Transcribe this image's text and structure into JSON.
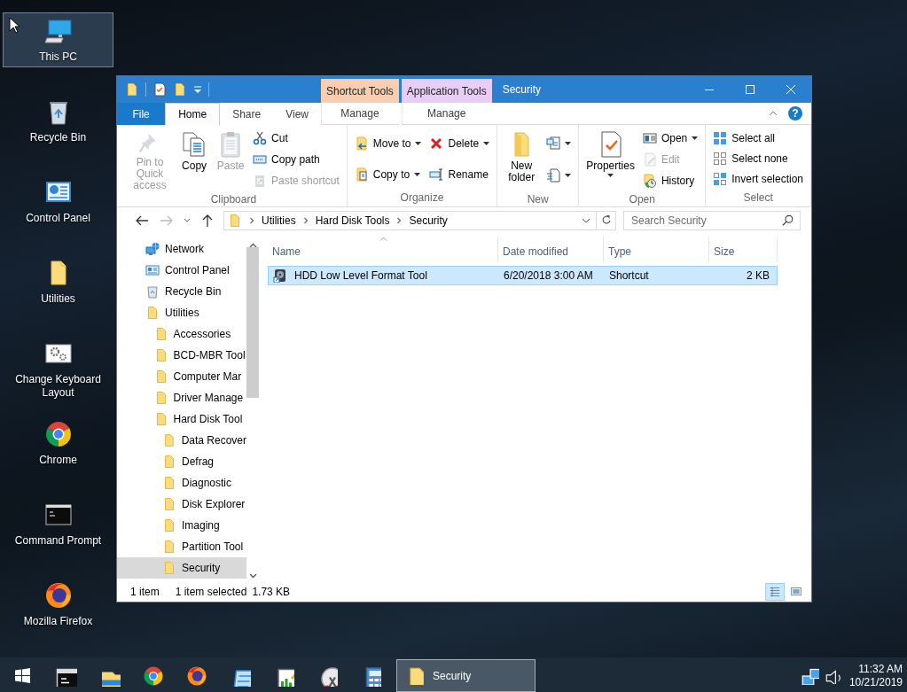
{
  "desktop": {
    "icons": [
      {
        "label": "This PC",
        "selected": true
      },
      {
        "label": "Recycle Bin",
        "selected": false
      },
      {
        "label": "Control Panel",
        "selected": false
      },
      {
        "label": "Utilities",
        "selected": false
      },
      {
        "label": "Change Keyboard Layout",
        "selected": false
      },
      {
        "label": "Chrome",
        "selected": false
      },
      {
        "label": "Command Prompt",
        "selected": false
      },
      {
        "label": "Mozilla Firefox",
        "selected": false
      }
    ]
  },
  "window": {
    "title": "Security",
    "contextual_tabs": [
      {
        "label": "Shortcut Tools",
        "color": "#f8cdb0"
      },
      {
        "label": "Application Tools",
        "color": "#e9cdf6"
      }
    ],
    "tabs": [
      {
        "label": "File",
        "kind": "file",
        "selected": false
      },
      {
        "label": "Home",
        "kind": "tab",
        "selected": true
      },
      {
        "label": "Share",
        "kind": "tab",
        "selected": false
      },
      {
        "label": "View",
        "kind": "tab",
        "selected": false
      },
      {
        "label": "Manage",
        "kind": "contextual",
        "selected": false
      },
      {
        "label": "Manage",
        "kind": "contextual",
        "selected": false
      }
    ],
    "help": "?",
    "ribbon": {
      "groups": [
        {
          "label": "Clipboard",
          "columns": [
            [
              {
                "label": "Pin to Quick access",
                "kind": "large",
                "disabled": true,
                "dropdown": false
              }
            ],
            [
              {
                "label": "Copy",
                "kind": "large",
                "disabled": false,
                "dropdown": false
              }
            ],
            [
              {
                "label": "Paste",
                "kind": "large",
                "disabled": true,
                "dropdown": false
              }
            ],
            [
              {
                "label": "Cut",
                "kind": "small",
                "disabled": false,
                "dropdown": false
              },
              {
                "label": "Copy path",
                "kind": "small",
                "disabled": false,
                "dropdown": false
              },
              {
                "label": "Paste shortcut",
                "kind": "small",
                "disabled": true,
                "dropdown": false
              }
            ]
          ]
        },
        {
          "label": "Organize",
          "columns": [
            [
              {
                "label": "Move to",
                "kind": "small",
                "disabled": false,
                "dropdown": true
              },
              {
                "label": "Copy to",
                "kind": "small",
                "disabled": false,
                "dropdown": true
              }
            ],
            [
              {
                "label": "Delete",
                "kind": "small",
                "disabled": false,
                "dropdown": true
              },
              {
                "label": "Rename",
                "kind": "small",
                "disabled": false,
                "dropdown": false
              }
            ]
          ]
        },
        {
          "label": "New",
          "columns": [
            [
              {
                "label": "New folder",
                "kind": "large",
                "disabled": false,
                "dropdown": false
              }
            ],
            [
              {
                "kind": "icon",
                "disabled": false,
                "dropdown": true
              },
              {
                "kind": "icon",
                "disabled": false,
                "dropdown": true
              }
            ]
          ]
        },
        {
          "label": "Open",
          "columns": [
            [
              {
                "label": "Properties",
                "kind": "large",
                "disabled": false,
                "dropdown": true
              }
            ],
            [
              {
                "label": "Open",
                "kind": "small",
                "disabled": false,
                "dropdown": true
              },
              {
                "label": "Edit",
                "kind": "small",
                "disabled": true,
                "dropdown": false
              },
              {
                "label": "History",
                "kind": "small",
                "disabled": false,
                "dropdown": false
              }
            ]
          ]
        },
        {
          "label": "Select",
          "columns": [
            [
              {
                "label": "Select all",
                "kind": "small",
                "disabled": false,
                "dropdown": false
              },
              {
                "label": "Select none",
                "kind": "small",
                "disabled": false,
                "dropdown": false
              },
              {
                "label": "Invert selection",
                "kind": "small",
                "disabled": false,
                "dropdown": false
              }
            ]
          ]
        }
      ]
    },
    "address": {
      "breadcrumbs": [
        "Utilities",
        "Hard Disk Tools",
        "Security"
      ],
      "search_placeholder": "Search Security"
    },
    "navigation": {
      "items": [
        {
          "label": "Network",
          "kind": "network",
          "selected": false
        },
        {
          "label": "Control Panel",
          "kind": "panel",
          "selected": false
        },
        {
          "label": "Recycle Bin",
          "kind": "bin",
          "selected": false
        },
        {
          "label": "Utilities",
          "kind": "folder",
          "selected": false,
          "children": [
            {
              "label": "Accessories",
              "kind": "folder",
              "selected": false
            },
            {
              "label": "BCD-MBR Tool",
              "kind": "folder",
              "selected": false
            },
            {
              "label": "Computer Mar",
              "kind": "folder",
              "selected": false
            },
            {
              "label": "Driver Manage",
              "kind": "folder",
              "selected": false
            },
            {
              "label": "Hard Disk Tool",
              "kind": "folder",
              "selected": false,
              "children": [
                {
                  "label": "Data Recover",
                  "kind": "folder",
                  "selected": false
                },
                {
                  "label": "Defrag",
                  "kind": "folder",
                  "selected": false
                },
                {
                  "label": "Diagnostic",
                  "kind": "folder",
                  "selected": false
                },
                {
                  "label": "Disk Explorer",
                  "kind": "folder",
                  "selected": false
                },
                {
                  "label": "Imaging",
                  "kind": "folder",
                  "selected": false
                },
                {
                  "label": "Partition Tool",
                  "kind": "folder",
                  "selected": false
                },
                {
                  "label": "Security",
                  "kind": "folder",
                  "selected": true
                }
              ]
            }
          ]
        }
      ]
    },
    "file_list": {
      "columns": [
        {
          "label": "Name",
          "sorted": true
        },
        {
          "label": "Date modified",
          "sorted": false
        },
        {
          "label": "Type",
          "sorted": false
        },
        {
          "label": "Size",
          "sorted": false
        }
      ],
      "rows": [
        {
          "cells": [
            "HDD Low Level Format Tool",
            "6/20/2018 3:00 AM",
            "Shortcut",
            "2 KB"
          ],
          "selected": true
        }
      ]
    },
    "status_bar": {
      "item_count": "1 item",
      "selection": "1 item selected",
      "selection_size": "1.73 KB",
      "views": [
        {
          "selected": true
        },
        {
          "selected": false
        }
      ]
    }
  },
  "taskbar": {
    "windows": [
      {
        "label": "Security",
        "selected": true
      }
    ],
    "clock": {
      "time": "11:32 AM",
      "date": "10/21/2019"
    }
  }
}
